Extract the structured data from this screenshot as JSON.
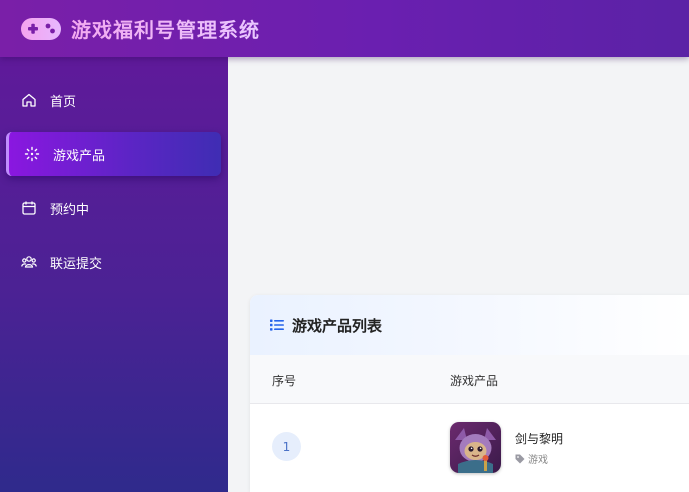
{
  "header": {
    "app_title": "游戏福利号管理系统",
    "logo_icon": "gamepad-icon"
  },
  "sidebar": {
    "items": [
      {
        "label": "首页",
        "icon": "home-icon",
        "active": false
      },
      {
        "label": "游戏产品",
        "icon": "game-product-icon",
        "active": true
      },
      {
        "label": "预约中",
        "icon": "calendar-icon",
        "active": false
      },
      {
        "label": "联运提交",
        "icon": "users-icon",
        "active": false
      }
    ]
  },
  "main": {
    "card": {
      "title": "游戏产品列表",
      "title_icon": "list-icon",
      "columns": [
        "序号",
        "游戏产品"
      ],
      "rows": [
        {
          "index": "1",
          "name": "剑与黎明",
          "tag": "游戏",
          "tag_icon": "tag-icon"
        }
      ]
    }
  },
  "colors": {
    "accent": "#2563eb",
    "header_start": "#7a1fa8",
    "sidebar_active": "#8a17e0",
    "title_gradient": "#f3a8f0"
  }
}
